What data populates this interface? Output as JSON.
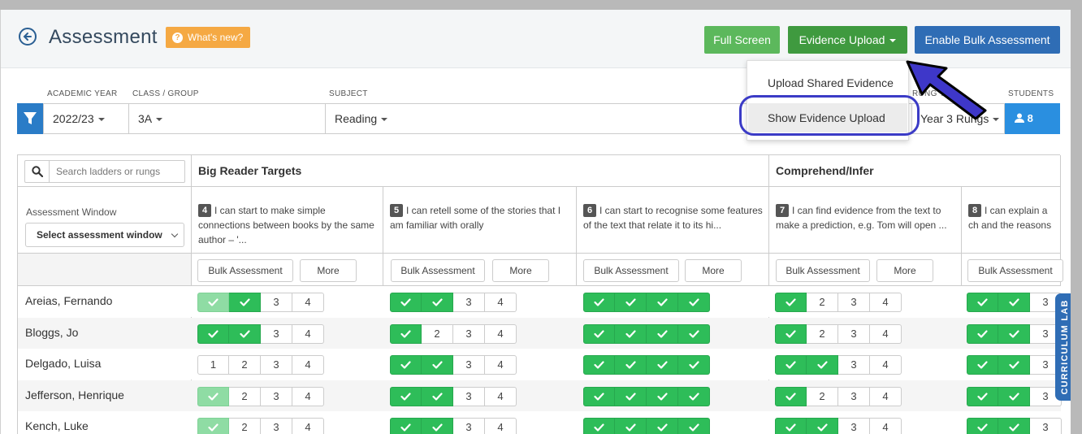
{
  "header": {
    "title": "Assessment",
    "whats_new": "What's new?",
    "full_screen": "Full Screen",
    "evidence_upload": "Evidence Upload",
    "enable_bulk": "Enable Bulk Assessment"
  },
  "dropdown": {
    "upload_shared": "Upload Shared Evidence",
    "show_upload": "Show Evidence Upload"
  },
  "filters": {
    "academic_year_label": "ACADEMIC YEAR",
    "class_label": "CLASS / GROUP",
    "subject_label": "SUBJECT",
    "rungs_label": "RUNG YE",
    "students_label": "STUDENTS",
    "academic_year": "2022/23",
    "class": "3A",
    "subject": "Reading",
    "rungs": "Year 3 Rungs",
    "students": "8"
  },
  "table": {
    "search_placeholder": "Search ladders or rungs",
    "assessment_window_label": "Assessment Window",
    "assessment_window_value": "Select assessment window",
    "groups": [
      "Big Reader Targets",
      "Comprehend/Infer"
    ],
    "bulk_label": "Bulk Assessment",
    "more_label": "More",
    "rungs": [
      {
        "num": "4",
        "text": "I can start to make simple connections between books by the same author – '..."
      },
      {
        "num": "5",
        "text": "I can retell some of the stories that I am familiar with orally"
      },
      {
        "num": "6",
        "text": "I can start to recognise some features of the text that relate it to its hi..."
      },
      {
        "num": "7",
        "text": "I can find evidence from the text to make a prediction, e.g. Tom will open ..."
      },
      {
        "num": "8",
        "text": "I can explain a ch and the reasons for t"
      }
    ],
    "students": [
      {
        "name": "Areias, Fernando",
        "cells": [
          [
            "p",
            "d",
            "3",
            "4"
          ],
          [
            "d",
            "d",
            "3",
            "4"
          ],
          [
            "d",
            "d",
            "d",
            "d"
          ],
          [
            "d",
            "2",
            "3",
            "4"
          ],
          [
            "d",
            "d",
            "3"
          ]
        ]
      },
      {
        "name": "Bloggs, Jo",
        "cells": [
          [
            "d",
            "d",
            "3",
            "4"
          ],
          [
            "d",
            "2",
            "3",
            "4"
          ],
          [
            "d",
            "d",
            "d",
            "d"
          ],
          [
            "d",
            "2",
            "3",
            "4"
          ],
          [
            "d",
            "d",
            "3"
          ]
        ]
      },
      {
        "name": "Delgado, Luisa",
        "cells": [
          [
            "1",
            "2",
            "3",
            "4"
          ],
          [
            "d",
            "d",
            "3",
            "4"
          ],
          [
            "d",
            "d",
            "d",
            "d"
          ],
          [
            "d",
            "d",
            "3",
            "4"
          ],
          [
            "d",
            "d",
            "3"
          ]
        ]
      },
      {
        "name": "Jefferson, Henrique",
        "cells": [
          [
            "p",
            "2",
            "3",
            "4"
          ],
          [
            "d",
            "d",
            "3",
            "4"
          ],
          [
            "d",
            "d",
            "d",
            "d"
          ],
          [
            "d",
            "2",
            "3",
            "4"
          ],
          [
            "d",
            "d",
            "3"
          ]
        ]
      },
      {
        "name": "Kench, Luke",
        "cells": [
          [
            "p",
            "2",
            "3",
            "4"
          ],
          [
            "d",
            "d",
            "3",
            "4"
          ],
          [
            "d",
            "d",
            "d",
            "d"
          ],
          [
            "d",
            "d",
            "3",
            "4"
          ],
          [
            "d",
            "d",
            "3"
          ]
        ]
      }
    ]
  },
  "side_tab": "CURRICULUM LAB",
  "icons": {
    "back": "back-arrow-circle-icon",
    "filter": "filter-icon",
    "search": "search-icon",
    "user": "user-icon",
    "check": "check-icon",
    "annotation_arrow": "pointer-arrow-icon"
  },
  "colors": {
    "done": "#2ebd59",
    "partial": "#8fdca4",
    "primary_blue": "#2f6db5",
    "green": "#3f9a3f",
    "orange": "#f5a943",
    "highlight": "#3b3bc6"
  }
}
